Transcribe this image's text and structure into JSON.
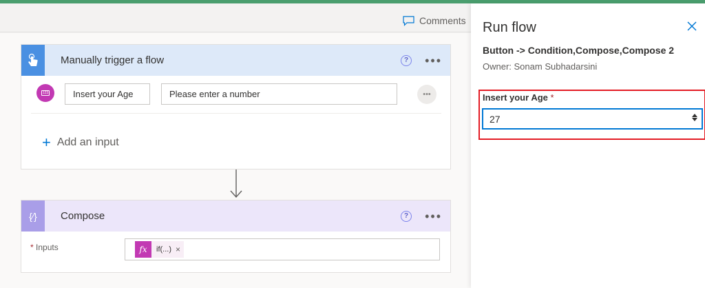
{
  "toolbar": {
    "comments_label": "Comments"
  },
  "trigger_card": {
    "title": "Manually trigger a flow",
    "help_glyph": "?",
    "more_glyph": "•••",
    "input_name": "Insert your Age",
    "input_placeholder": "Please enter a number",
    "input_options_glyph": "•••",
    "add_input_label": "Add an input",
    "badge_text": "123"
  },
  "compose_card": {
    "title": "Compose",
    "icon_glyph": "{∕}",
    "help_glyph": "?",
    "more_glyph": "•••",
    "inputs_label": "Inputs",
    "required_mark": "*",
    "token_fx": "fx",
    "token_label": "if(...)",
    "token_remove": "×"
  },
  "run_panel": {
    "title": "Run flow",
    "flow_name": "Button -> Condition,Compose,Compose 2",
    "owner": "Owner: Sonam Subhadarsini",
    "field_label": "Insert your Age",
    "required_mark": "*",
    "field_value": "27"
  },
  "colors": {
    "accent": "#0078d4",
    "trigger_icon_bg": "#4a90e2",
    "compose_icon_bg": "#a99ee8",
    "highlight_border": "#e31b23",
    "top_bar": "#4a9e6e"
  }
}
